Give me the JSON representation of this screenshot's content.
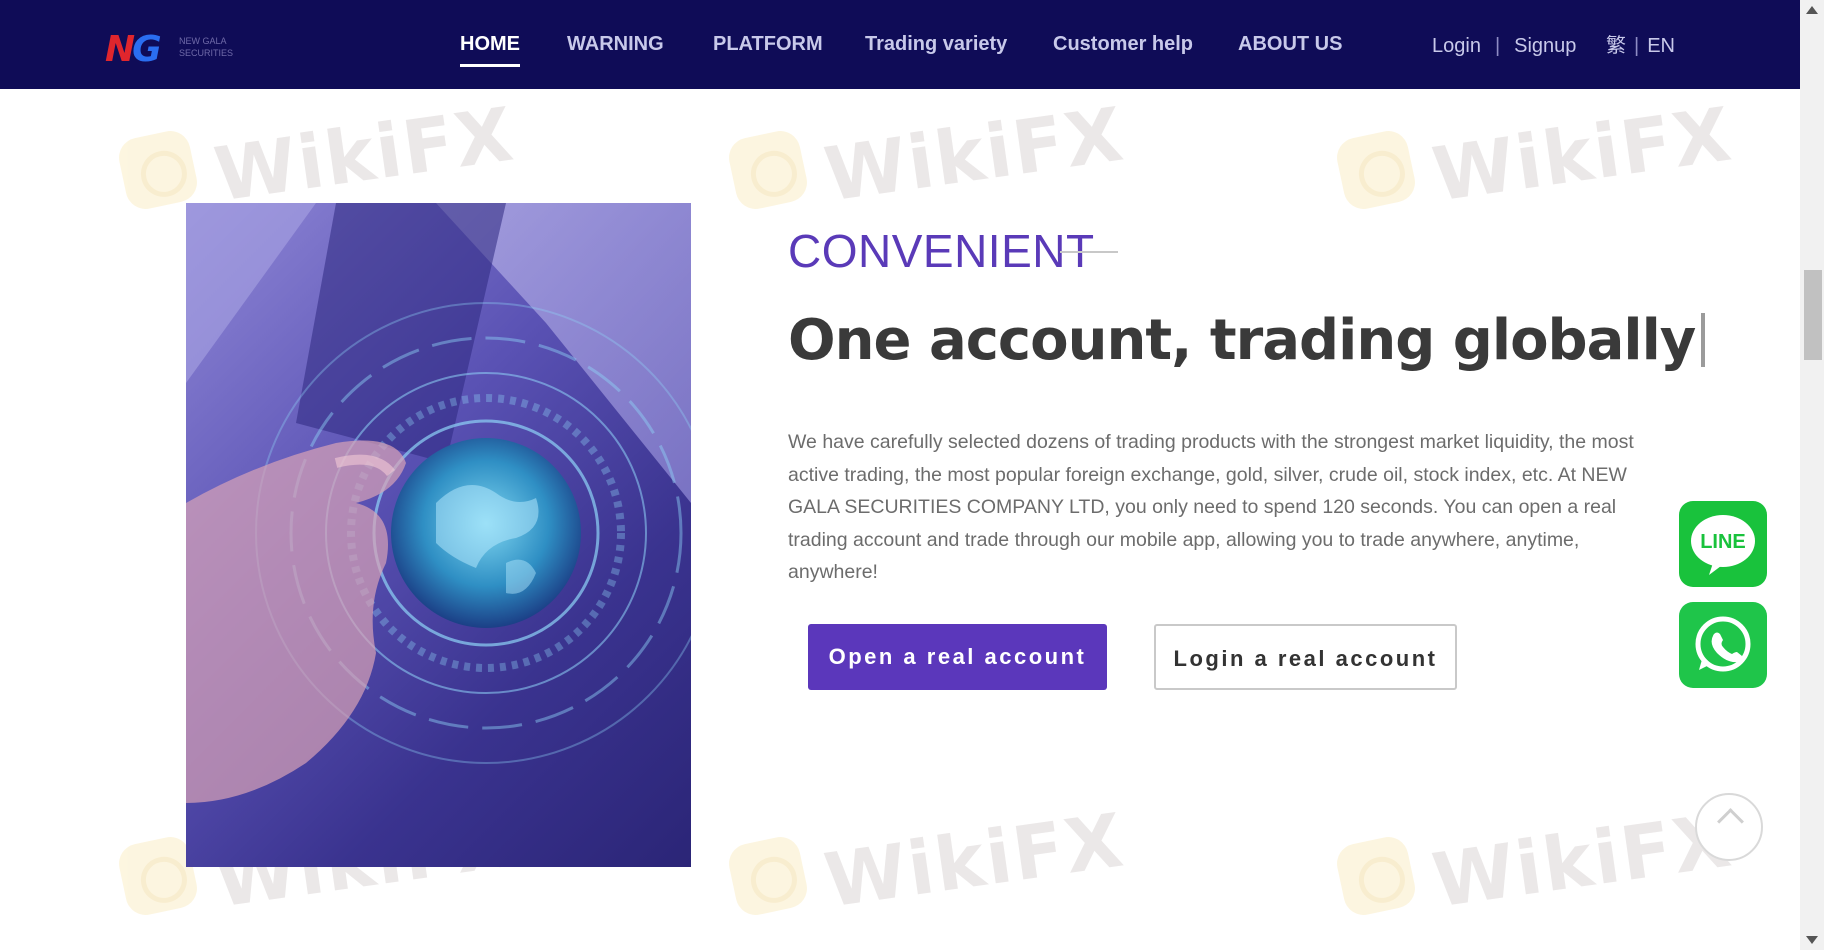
{
  "header": {
    "logo": {
      "mark_n": "N",
      "mark_g": "G",
      "sub": "NEW GALA SECURITIES"
    },
    "nav": [
      {
        "label": "HOME",
        "active": true
      },
      {
        "label": "WARNING",
        "active": false
      },
      {
        "label": "PLATFORM",
        "active": false
      },
      {
        "label": "Trading variety",
        "active": false
      },
      {
        "label": "Customer help",
        "active": false
      },
      {
        "label": "ABOUT US",
        "active": false
      }
    ],
    "auth": {
      "login": "Login",
      "separator": "|",
      "signup": "Signup"
    },
    "lang": {
      "trad": "繁",
      "separator": "|",
      "en": "EN"
    }
  },
  "watermark": {
    "text": "WikiFX"
  },
  "content": {
    "eyebrow": "CONVENIENT",
    "headline": "One account, trading globally",
    "paragraph": "We have carefully selected dozens of trading products with the strongest market liquidity, the most active trading, the most popular foreign exchange, gold, silver, crude oil, stock index, etc. At NEW GALA SECURITIES COMPANY LTD, you only need to spend 120 seconds. You can open a real trading account and trade through our mobile app, allowing you to trade anywhere, anytime, anywhere!",
    "buttons": {
      "open": "Open a real account",
      "login": "Login a real account"
    }
  },
  "floating": {
    "line_label": "LINE",
    "whatsapp_icon": "whatsapp-icon",
    "top_icon": "chevron-up-icon"
  },
  "colors": {
    "nav_bg": "#0f0c57",
    "accent": "#5b37bb",
    "eyebrow": "#5a3ab8",
    "line_green": "#19c23c",
    "whatsapp_green": "#1fc54a"
  }
}
